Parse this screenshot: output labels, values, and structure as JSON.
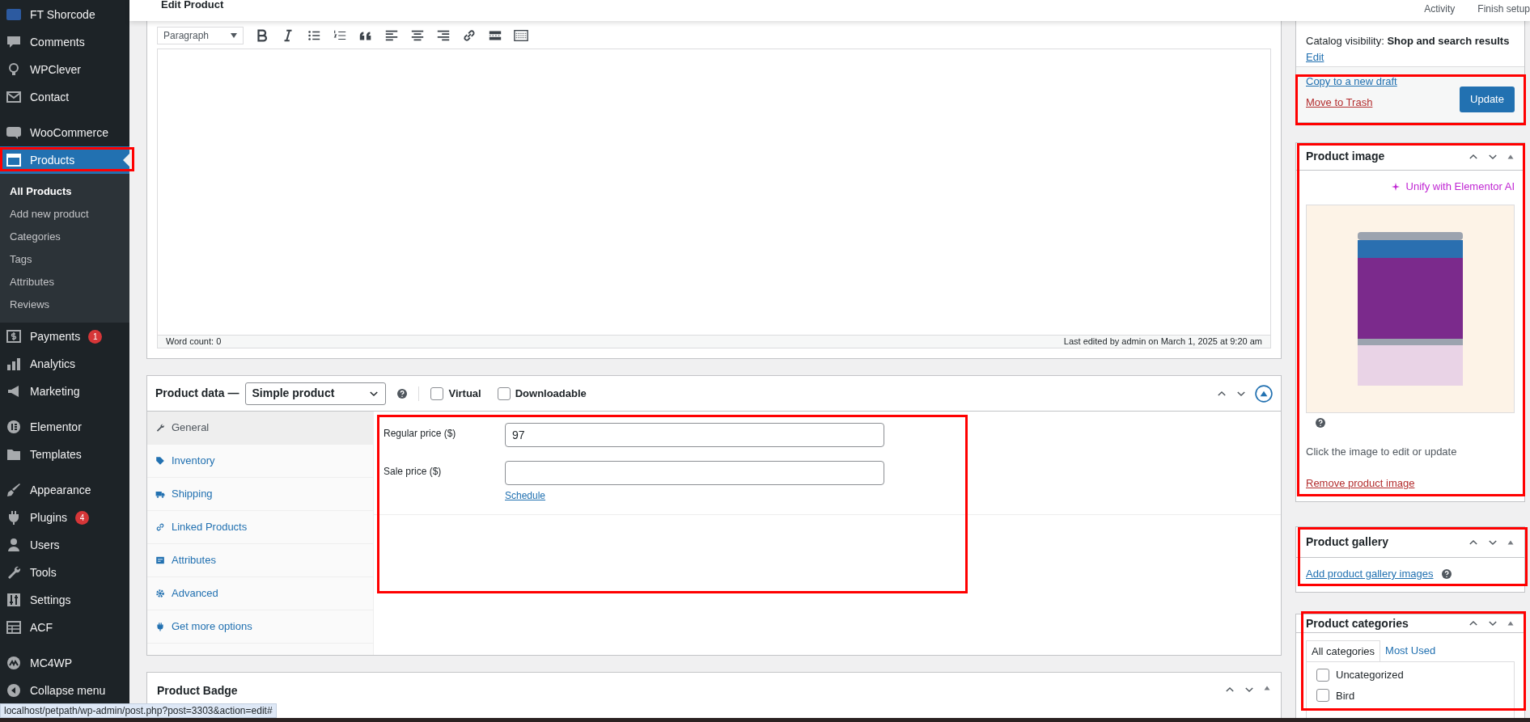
{
  "admin_menu": {
    "groups": [
      [
        {
          "label": "FT Shorcode",
          "selected": false
        },
        {
          "label": "Comments",
          "selected": false
        },
        {
          "label": "WPClever",
          "selected": false
        },
        {
          "label": "Contact",
          "selected": false
        }
      ],
      [
        {
          "label": "WooCommerce",
          "selected": false
        },
        {
          "label": "Products",
          "selected": true,
          "submenu": [
            {
              "label": "All Products",
              "selected": true
            },
            {
              "label": "Add new product",
              "selected": false
            },
            {
              "label": "Categories",
              "selected": false
            },
            {
              "label": "Tags",
              "selected": false
            },
            {
              "label": "Attributes",
              "selected": false
            },
            {
              "label": "Reviews",
              "selected": false
            }
          ]
        },
        {
          "label": "Payments",
          "selected": false,
          "badge": "1"
        },
        {
          "label": "Analytics",
          "selected": false
        },
        {
          "label": "Marketing",
          "selected": false
        }
      ],
      [
        {
          "label": "Elementor",
          "selected": false
        },
        {
          "label": "Templates",
          "selected": false
        }
      ],
      [
        {
          "label": "Appearance",
          "selected": false
        },
        {
          "label": "Plugins",
          "selected": false,
          "badge": "4"
        },
        {
          "label": "Users",
          "selected": false
        },
        {
          "label": "Tools",
          "selected": false
        },
        {
          "label": "Settings",
          "selected": false
        },
        {
          "label": "ACF",
          "selected": false
        }
      ],
      [
        {
          "label": "MC4WP",
          "selected": false
        },
        {
          "label": "Collapse menu",
          "selected": false
        }
      ]
    ]
  },
  "header": {
    "title": "Edit Product",
    "links": [
      "Activity",
      "Finish setup"
    ]
  },
  "editor": {
    "format": "Paragraph",
    "word_count": "Word count: 0",
    "last_edited": "Last edited by admin on March 1, 2025 at 9:20 am"
  },
  "product_data": {
    "title": "Product data —",
    "type": "Simple product",
    "options": [
      {
        "label": "Virtual",
        "checked": false
      },
      {
        "label": "Downloadable",
        "checked": false
      }
    ],
    "tabs": [
      {
        "label": "General",
        "selected": true
      },
      {
        "label": "Inventory",
        "selected": false
      },
      {
        "label": "Shipping",
        "selected": false
      },
      {
        "label": "Linked Products",
        "selected": false
      },
      {
        "label": "Attributes",
        "selected": false
      },
      {
        "label": "Advanced",
        "selected": false
      },
      {
        "label": "Get more options",
        "selected": false
      }
    ],
    "fields": [
      {
        "label": "Regular price ($)",
        "value": "97"
      },
      {
        "label": "Sale price ($)"
      }
    ],
    "schedule_link": "Schedule"
  },
  "product_badge": {
    "title": "Product Badge"
  },
  "publish": {
    "visibility_label": "Catalog visibility:",
    "visibility_value": "Shop and search results",
    "edit_link": "Edit",
    "copy_link": "Copy to a new draft",
    "trash_link": "Move to Trash",
    "update_button": "Update"
  },
  "product_image": {
    "title": "Product image",
    "ai_link": "Unify with Elementor AI",
    "hint": "Click the image to edit or update",
    "remove_link": "Remove product image"
  },
  "product_gallery": {
    "title": "Product gallery",
    "add_link": "Add product gallery images"
  },
  "product_categories": {
    "title": "Product categories",
    "tabs": [
      {
        "label": "All categories",
        "selected": true
      },
      {
        "label": "Most Used",
        "selected": false
      }
    ],
    "items": [
      {
        "label": "Uncategorized",
        "checked": false
      },
      {
        "label": "Bird",
        "checked": false
      }
    ]
  },
  "status_url": "localhost/petpath/wp-admin/post.php?post=3303&action=edit#"
}
